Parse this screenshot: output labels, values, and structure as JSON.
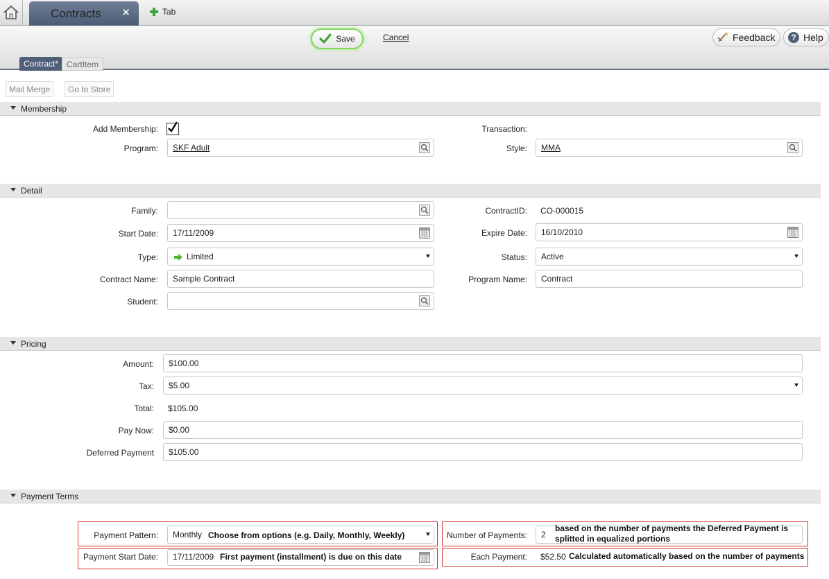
{
  "top_tabs": {
    "active": "Contracts",
    "new_tab": "Tab"
  },
  "toolbar": {
    "save": "Save",
    "cancel": "Cancel",
    "feedback": "Feedback",
    "help": "Help"
  },
  "subtabs": [
    "Contract*",
    "CartItem"
  ],
  "actions": [
    "Mail Merge",
    "Go to Store"
  ],
  "sections": {
    "membership": "Membership",
    "detail": "Detail",
    "pricing": "Pricing",
    "payment_terms": "Payment Terms"
  },
  "membership": {
    "add_membership_label": "Add Membership:",
    "add_membership_checked": true,
    "program_label": "Program:",
    "program_value": "SKF Adult",
    "transaction_label": "Transaction:",
    "style_label": "Style:",
    "style_value": "MMA"
  },
  "detail": {
    "family_label": "Family:",
    "family_value": "",
    "start_date_label": "Start Date:",
    "start_date_value": "17/11/2009",
    "type_label": "Type:",
    "type_value": "Limited",
    "contract_name_label": "Contract Name:",
    "contract_name_value": "Sample Contract",
    "student_label": "Student:",
    "student_value": "",
    "contract_id_label": "ContractID:",
    "contract_id_value": "CO-000015",
    "expire_date_label": "Expire Date:",
    "expire_date_value": "16/10/2010",
    "status_label": "Status:",
    "status_value": "Active",
    "program_name_label": "Program Name:",
    "program_name_value": "Contract"
  },
  "pricing": {
    "amount_label": "Amount:",
    "amount_value": "$100.00",
    "tax_label": "Tax:",
    "tax_value": "$5.00",
    "total_label": "Total:",
    "total_value": "$105.00",
    "pay_now_label": "Pay Now:",
    "pay_now_value": "$0.00",
    "deferred_label": "Deferred Payment",
    "deferred_value": "$105.00"
  },
  "payment_terms": {
    "pattern_label": "Payment Pattern:",
    "pattern_value": "Monthly",
    "pattern_note": "Choose from options (e.g. Daily, Monthly, Weekly)",
    "start_date_label": "Payment Start Date:",
    "start_date_value": "17/11/2009",
    "start_date_note": "First payment (installment) is due on this date",
    "num_payments_label": "Number of Payments:",
    "num_payments_value": "2",
    "num_payments_note": "based on the number of payments the Deferred Payment is splitted in equalized portions",
    "each_payment_label": "Each Payment:",
    "each_payment_value": "$52.50",
    "each_payment_note": "Calculated automatically based on the number of payments"
  },
  "colors": {
    "tab_blue": "#4f5f78",
    "highlight_red": "#d0312d",
    "save_glow": "#7ed957"
  }
}
